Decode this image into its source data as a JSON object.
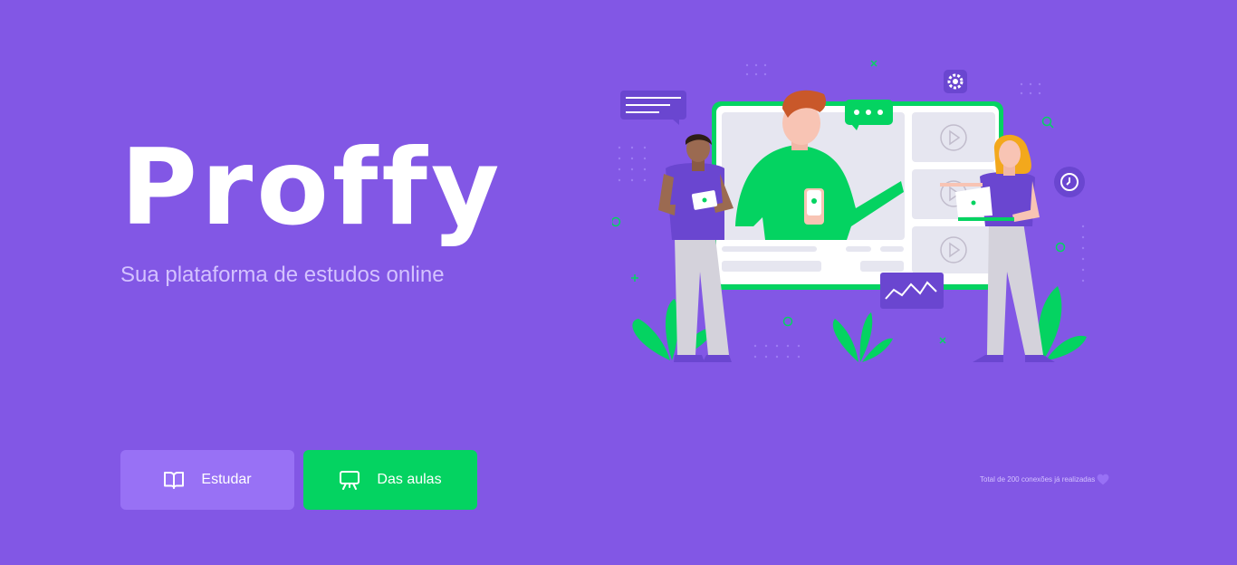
{
  "brand": {
    "name": "Proffy"
  },
  "tagline": "Sua plataforma de estudos online",
  "actions": {
    "study_label": "Estudar",
    "give_classes_label": "Das aulas"
  },
  "connections": {
    "text": "Total de 200 conexões já realizadas",
    "icon": "heart-icon"
  },
  "colors": {
    "background": "#8257e5",
    "primary_light": "#9871f5",
    "secondary": "#04d361",
    "text_light": "#d4c2ff"
  },
  "icons": {
    "study": "book-icon",
    "give_classes": "presentation-icon"
  }
}
